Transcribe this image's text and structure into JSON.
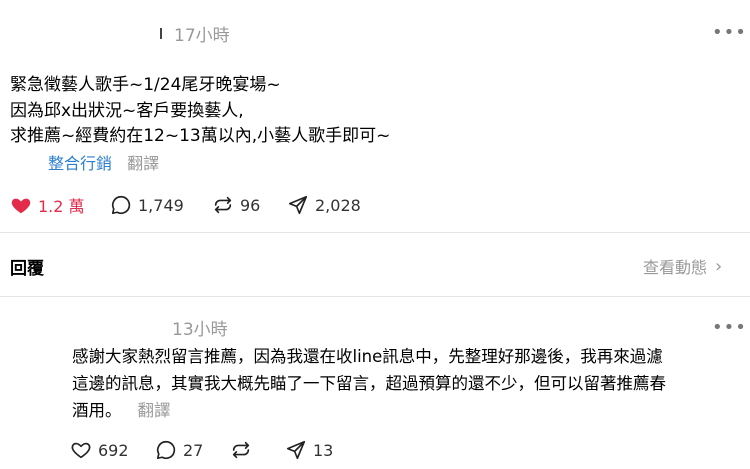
{
  "post": {
    "time": "17小時",
    "lines": [
      "緊急徵藝人歌手~1/24尾牙晚宴場~",
      "因為邱x出狀況~客戶要換藝人,",
      "求推薦~經費約在12~13萬以內,小藝人歌手即可~"
    ],
    "tag": "整合行銷",
    "translate": "翻譯",
    "stats": {
      "likes": "1.2 萬",
      "comments": "1,749",
      "reposts": "96",
      "shares": "2,028"
    },
    "like_color": "#e32b4b"
  },
  "replies_bar": {
    "title": "回覆",
    "activity": "查看動態"
  },
  "reply": {
    "time": "13小時",
    "lines": [
      "感謝大家熱烈留言推薦，因為我還在收line訊息中，先整理好那邊後，我再來過濾",
      "這邊的訊息，其實我大概先瞄了一下留言，超過預算的還不少，但可以留著推薦春",
      "酒用。"
    ],
    "translate": "翻譯",
    "stats": {
      "likes": "692",
      "comments": "27",
      "reposts": "",
      "shares": "13"
    }
  },
  "icons": [
    "more-icon",
    "heart-icon",
    "comment-icon",
    "repost-icon",
    "share-icon",
    "chevron-right-icon"
  ]
}
